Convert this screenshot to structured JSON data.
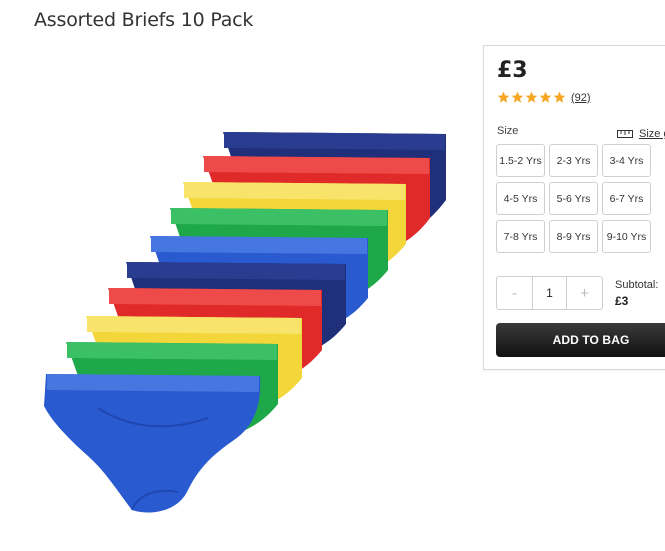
{
  "product": {
    "title": "Assorted Briefs 10 Pack",
    "image_alt": "Stack of ten assorted colour briefs"
  },
  "panel": {
    "price": "£3",
    "rating": {
      "stars": 5,
      "review_count": "(92)",
      "star_color": "#f5a623"
    },
    "size_label": "Size",
    "size_guide_label": "Size guide",
    "sizes": [
      "1.5-2 Yrs",
      "2-3 Yrs",
      "3-4 Yrs",
      "4-5 Yrs",
      "5-6 Yrs",
      "6-7 Yrs",
      "7-8 Yrs",
      "8-9 Yrs",
      "9-10 Yrs"
    ],
    "quantity": {
      "minus": "-",
      "value": "1",
      "plus": "+"
    },
    "subtotal_label": "Subtotal:",
    "subtotal_value": "£3",
    "add_to_bag": "ADD TO BAG"
  },
  "colors": {
    "navy": "#1f2f7a",
    "red": "#e02a2a",
    "yellow": "#f2d63a",
    "green": "#1ea84a",
    "blue": "#2a5ad0"
  }
}
